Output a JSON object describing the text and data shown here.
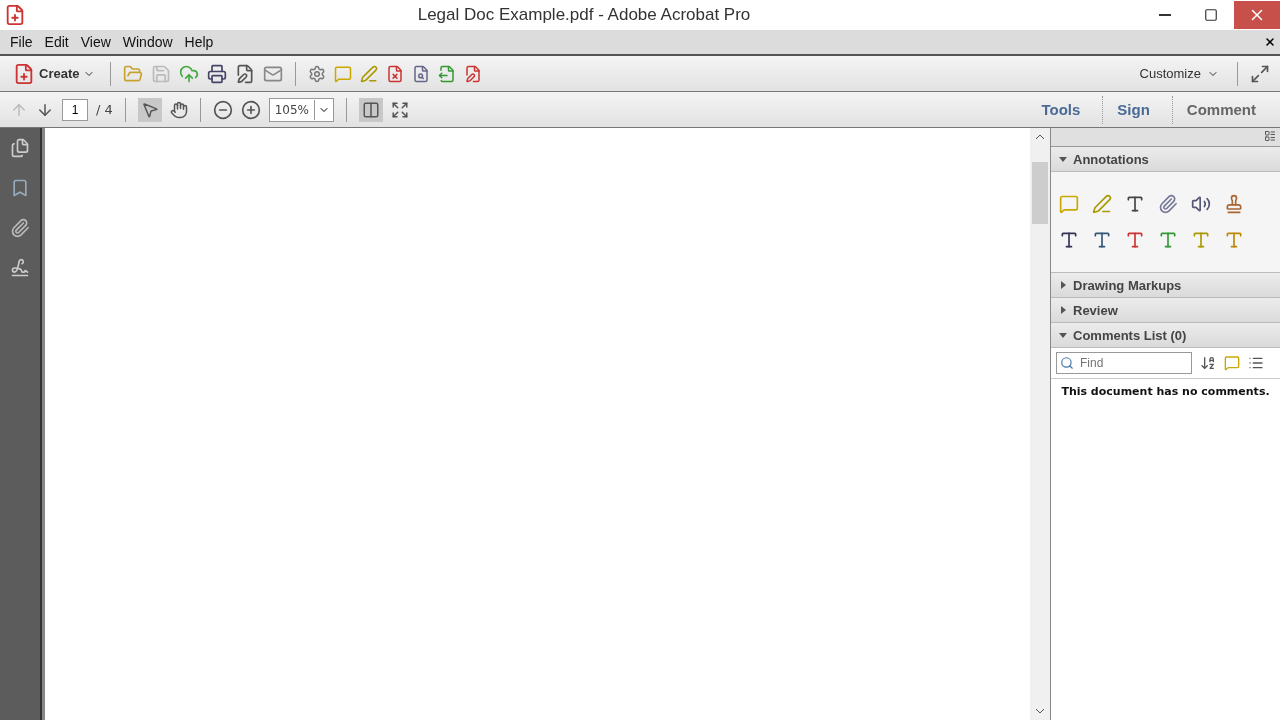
{
  "window": {
    "title": "Legal Doc Example.pdf - Adobe Acrobat Pro"
  },
  "menu": [
    "File",
    "Edit",
    "View",
    "Window",
    "Help"
  ],
  "toolbar": {
    "create": "Create",
    "customize": "Customize"
  },
  "nav": {
    "page": "1",
    "of": "/ 4",
    "zoom": "105%"
  },
  "tabs": [
    {
      "label": "Tools",
      "selected": false
    },
    {
      "label": "Sign",
      "selected": false
    },
    {
      "label": "Comment",
      "selected": true
    }
  ],
  "panel": {
    "sections": [
      {
        "title": "Annotations",
        "expanded": true
      },
      {
        "title": "Drawing Markups",
        "expanded": false
      },
      {
        "title": "Review",
        "expanded": false
      },
      {
        "title": "Comments List (0)",
        "expanded": true
      }
    ],
    "search": {
      "placeholder": "Find"
    },
    "empty": "This document has no comments."
  }
}
